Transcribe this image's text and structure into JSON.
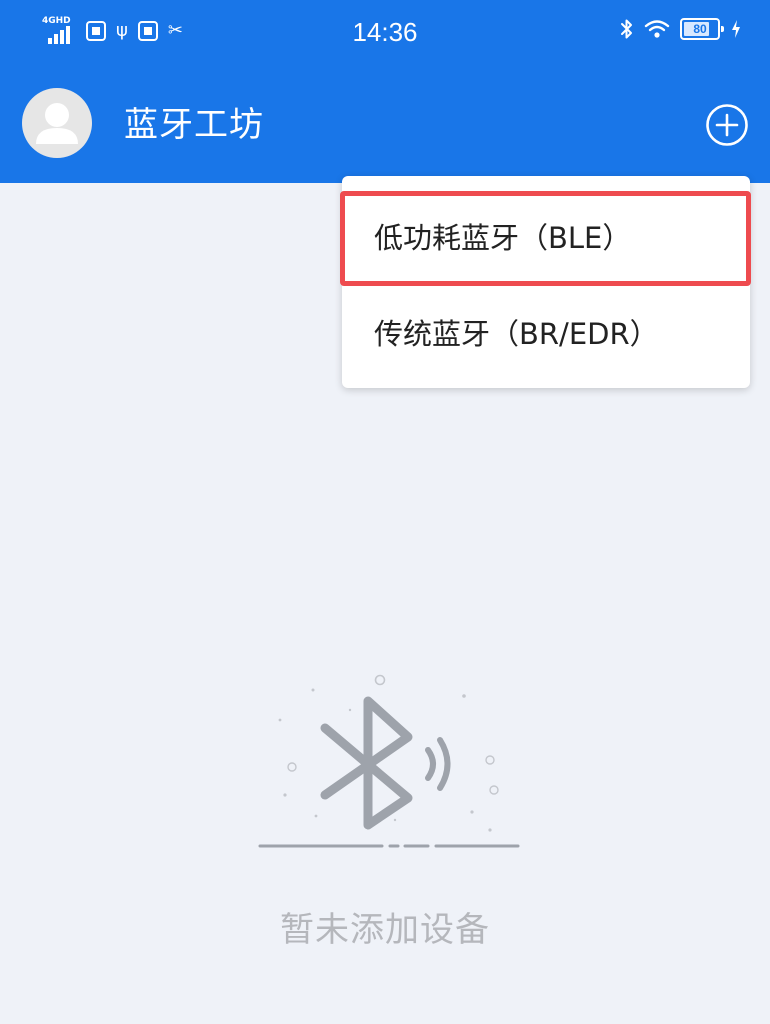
{
  "status_bar": {
    "network_label": "4GHD",
    "time": "14:36",
    "battery_level": "80",
    "icons": [
      "signal-icon",
      "sim-icon",
      "usb-icon",
      "notification-icon",
      "tools-icon",
      "bluetooth-icon",
      "wifi-icon",
      "battery-icon",
      "charging-icon"
    ]
  },
  "header": {
    "title": "蓝牙工坊",
    "colors": {
      "background": "#1976e8",
      "text": "#ffffff"
    }
  },
  "popup_menu": {
    "items": [
      {
        "label": "低功耗蓝牙（BLE）",
        "highlighted": true
      },
      {
        "label": "传统蓝牙（BR/EDR）",
        "highlighted": false
      }
    ],
    "highlight_color": "#ee4b4f"
  },
  "empty_state": {
    "icon": "bluetooth-icon",
    "message": "暂未添加设备"
  },
  "colors": {
    "page_background": "#eff2f8",
    "muted_text": "#b5b7bc"
  }
}
